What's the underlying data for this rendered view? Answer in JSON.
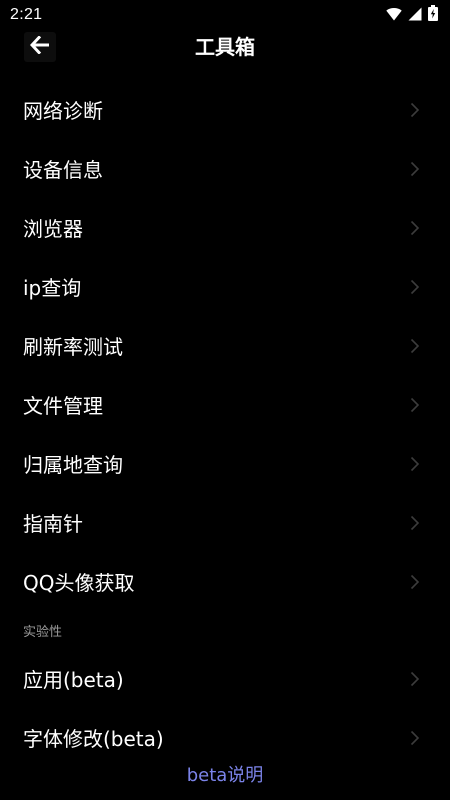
{
  "status_bar": {
    "time": "2:21"
  },
  "app_bar": {
    "title": "工具箱"
  },
  "menu": {
    "items": [
      {
        "label": "网络诊断"
      },
      {
        "label": "设备信息"
      },
      {
        "label": "浏览器"
      },
      {
        "label": "ip查询"
      },
      {
        "label": "刷新率测试"
      },
      {
        "label": "文件管理"
      },
      {
        "label": "归属地查询"
      },
      {
        "label": "指南针"
      },
      {
        "label": "QQ头像获取"
      }
    ],
    "experimental_header": "实验性",
    "experimental_items": [
      {
        "label": "应用(beta)"
      },
      {
        "label": "字体修改(beta)"
      }
    ]
  },
  "footer": {
    "link_label": "beta说明"
  },
  "colors": {
    "background": "#000000",
    "text": "#ffffff",
    "chevron": "#3c3c3c",
    "section_header": "#9a9a9a",
    "link": "#7b83e8"
  }
}
